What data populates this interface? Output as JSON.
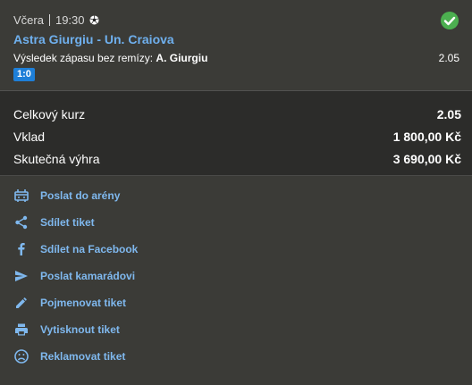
{
  "match": {
    "day": "Včera",
    "time": "19:30",
    "teams": "Astra Giurgiu - Un. Craiova",
    "market_label": "Výsledek zápasu bez remízy:",
    "selection": "A. Giurgiu",
    "odd": "2.05",
    "score": "1:0"
  },
  "summary": {
    "total_odds_label": "Celkový kurz",
    "total_odds_value": "2.05",
    "stake_label": "Vklad",
    "stake_value": "1 800,00 Kč",
    "win_label": "Skutečná výhra",
    "win_value": "3 690,00 Kč"
  },
  "actions": [
    {
      "label": "Poslat do arény",
      "icon": "arena-icon"
    },
    {
      "label": "Sdílet tiket",
      "icon": "share-icon"
    },
    {
      "label": "Sdílet na Facebook",
      "icon": "facebook-icon"
    },
    {
      "label": "Poslat kamarádovi",
      "icon": "send-icon"
    },
    {
      "label": "Pojmenovat tiket",
      "icon": "pencil-icon"
    },
    {
      "label": "Vytisknout tiket",
      "icon": "print-icon"
    },
    {
      "label": "Reklamovat tiket",
      "icon": "complaint-icon"
    }
  ],
  "colors": {
    "accent_blue": "#7fb8ee",
    "team_blue": "#6fb0ee",
    "win_green": "#4caf50",
    "score_badge": "#1e7fd8"
  }
}
